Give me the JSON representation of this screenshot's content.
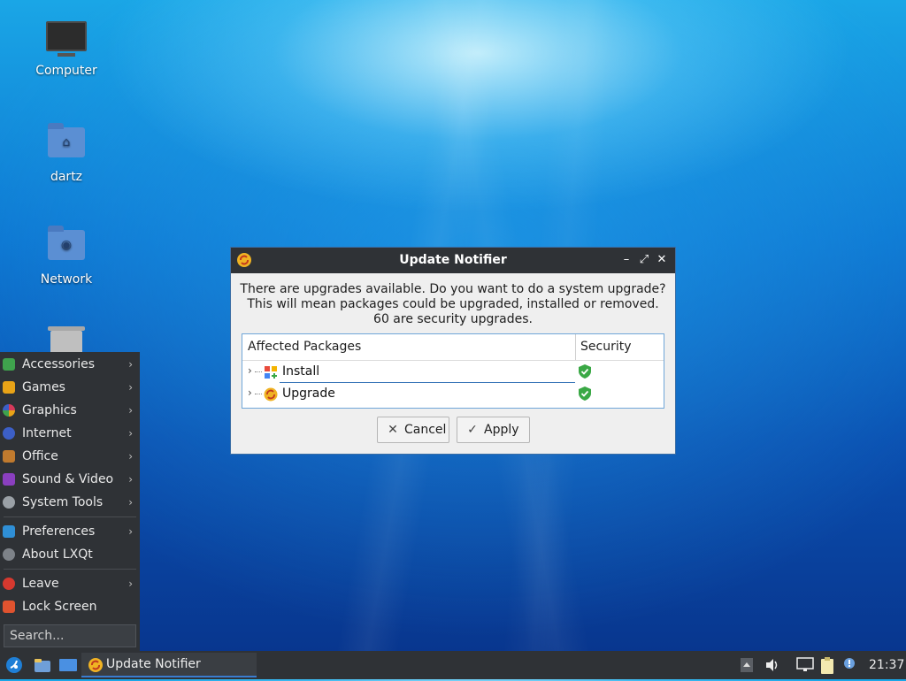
{
  "desktop": {
    "icons": [
      {
        "label": "Computer"
      },
      {
        "label": "dartz"
      },
      {
        "label": "Network"
      }
    ]
  },
  "app_menu": {
    "categories": [
      {
        "label": "Accessories",
        "color": "#3fa34d"
      },
      {
        "label": "Games",
        "color": "#e8a317"
      },
      {
        "label": "Graphics",
        "color": "#d6395a"
      },
      {
        "label": "Internet",
        "color": "#3c5fc7"
      },
      {
        "label": "Office",
        "color": "#c07a2e"
      },
      {
        "label": "Sound & Video",
        "color": "#8a3fbf"
      },
      {
        "label": "System Tools",
        "color": "#9aa0a6"
      }
    ],
    "preferences": "Preferences",
    "about": "About LXQt",
    "leave": "Leave",
    "lock_screen": "Lock Screen",
    "search_placeholder": "Search..."
  },
  "dialog": {
    "title": "Update Notifier",
    "message_lines": [
      "There are upgrades available. Do you want to do a system upgrade?",
      "This will mean packages could be upgraded, installed or removed.",
      "60 are security upgrades."
    ],
    "columns": [
      "Affected Packages",
      "Security"
    ],
    "rows": [
      {
        "label": "Install"
      },
      {
        "label": "Upgrade"
      }
    ],
    "cancel_label": "Cancel",
    "apply_label": "Apply"
  },
  "taskbar": {
    "task_label": "Update Notifier",
    "clock": "21:37"
  },
  "colors": {
    "accent": "#3b7ccf",
    "panel": "#2f3236",
    "shield_green": "#3aa845"
  }
}
